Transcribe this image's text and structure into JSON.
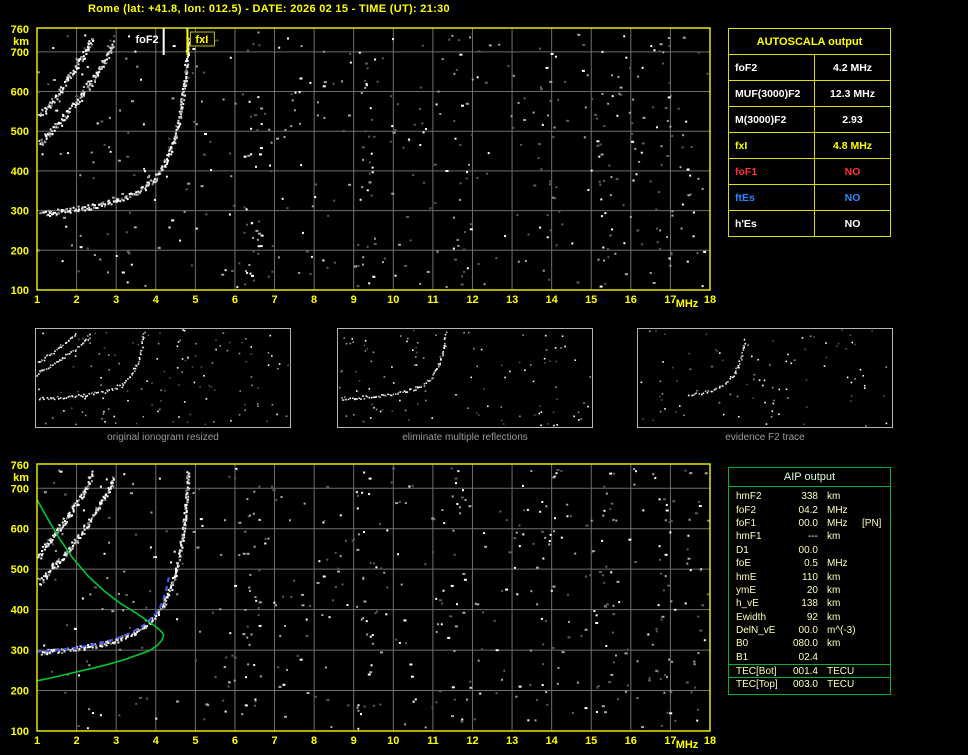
{
  "header": {
    "title": "Rome (lat: +41.8, lon: 012.5) - DATE: 2026 02 15 - TIME (UT): 21:30"
  },
  "autoscala": {
    "title": "AUTOSCALA output",
    "rows": [
      {
        "param": "foF2",
        "value": "4.2 MHz",
        "color": "#ffffff"
      },
      {
        "param": "MUF(3000)F2",
        "value": "12.3 MHz",
        "color": "#ffffff"
      },
      {
        "param": "M(3000)F2",
        "value": "2.93",
        "color": "#ffffff"
      },
      {
        "param": "fxI",
        "value": "4.8 MHz",
        "color": "#ffff00"
      },
      {
        "param": "foF1",
        "value": "NO",
        "color": "#ff3232"
      },
      {
        "param": "ftEs",
        "value": "NO",
        "color": "#2e86ff"
      },
      {
        "param": "h'Es",
        "value": "NO",
        "color": "#ffffff"
      }
    ]
  },
  "aip": {
    "title": "AIP output",
    "rows": [
      {
        "param": "hmF2",
        "value": "338",
        "unit": "km",
        "note": "",
        "sep": false
      },
      {
        "param": "foF2",
        "value": "04.2",
        "unit": "MHz",
        "note": "",
        "sep": false
      },
      {
        "param": "foF1",
        "value": "00.0",
        "unit": "MHz",
        "note": "[PN]",
        "sep": false
      },
      {
        "param": "hmF1",
        "value": "---",
        "unit": "km",
        "note": "",
        "sep": false
      },
      {
        "param": "D1",
        "value": "00.0",
        "unit": "",
        "note": "",
        "sep": false
      },
      {
        "param": "foE",
        "value": "0.5",
        "unit": "MHz",
        "note": "",
        "sep": false
      },
      {
        "param": "hmE",
        "value": "110",
        "unit": "km",
        "note": "",
        "sep": false
      },
      {
        "param": "ymE",
        "value": "20",
        "unit": "km",
        "note": "",
        "sep": false
      },
      {
        "param": "h_vE",
        "value": "138",
        "unit": "km",
        "note": "",
        "sep": false
      },
      {
        "param": "Ewidth",
        "value": "92",
        "unit": "km",
        "note": "",
        "sep": false
      },
      {
        "param": "DelN_vE",
        "value": "00.0",
        "unit": "m^(-3)",
        "note": "",
        "sep": false
      },
      {
        "param": "B0",
        "value": "080.0",
        "unit": "km",
        "note": "",
        "sep": false
      },
      {
        "param": "B1",
        "value": "02.4",
        "unit": "",
        "note": "",
        "sep": false
      },
      {
        "param": "TEC[Bot]",
        "value": "001.4",
        "unit": "TECU",
        "note": "",
        "sep": true
      },
      {
        "param": "TEC[Top]",
        "value": "003.0",
        "unit": "TECU",
        "note": "",
        "sep": true
      }
    ]
  },
  "thumbnails": [
    {
      "caption": "original ionogram resized",
      "trace_names": [
        "F-trace",
        "second-hop-a",
        "second-hop-b"
      ],
      "noise": 130,
      "seed": 41
    },
    {
      "caption": "eliminate multiple reflections",
      "trace_names": [
        "F-trace"
      ],
      "noise": 110,
      "seed": 53
    },
    {
      "caption": "evidence F2 trace",
      "trace_points": [
        [
          2.8,
          320
        ],
        [
          3.2,
          333
        ],
        [
          3.6,
          352
        ],
        [
          3.9,
          375
        ],
        [
          4.1,
          400
        ],
        [
          4.28,
          434
        ],
        [
          4.42,
          470
        ],
        [
          4.53,
          510
        ],
        [
          4.62,
          555
        ],
        [
          4.69,
          602
        ],
        [
          4.74,
          650
        ],
        [
          4.78,
          700
        ]
      ],
      "noise": 90,
      "seed": 67
    }
  ],
  "chart_data": [
    {
      "name": "main-ionogram",
      "type": "scatter",
      "xlabel": "MHz",
      "ylabel": "km",
      "xlim": [
        1,
        18
      ],
      "ylim": [
        100,
        760
      ],
      "xticks": [
        1,
        2,
        3,
        4,
        5,
        6,
        7,
        8,
        9,
        10,
        11,
        12,
        13,
        14,
        15,
        16,
        17,
        18
      ],
      "yticks": [
        100,
        200,
        300,
        400,
        500,
        600,
        700,
        760
      ],
      "grid": true,
      "markers": [
        {
          "label": "foF2",
          "x": 4.2,
          "color": "#ffffff",
          "boxed": false
        },
        {
          "label": "fxI",
          "x": 4.8,
          "color": "#ffff00",
          "boxed": true
        }
      ],
      "noise": {
        "count": 520,
        "seed": 11,
        "band_freqs": [
          6.4,
          9.3,
          11.7,
          13.9,
          15.3,
          16.8
        ],
        "band_fraction": 0.25
      },
      "traces": [
        {
          "name": "F-trace",
          "spread": 5,
          "density": 2,
          "points": [
            [
              1.1,
              296
            ],
            [
              1.6,
              300
            ],
            [
              2.1,
              307
            ],
            [
              2.6,
              316
            ],
            [
              3.0,
              327
            ],
            [
              3.4,
              342
            ],
            [
              3.7,
              360
            ],
            [
              3.95,
              381
            ],
            [
              4.12,
              404
            ],
            [
              4.28,
              434
            ],
            [
              4.42,
              470
            ],
            [
              4.53,
              510
            ],
            [
              4.62,
              555
            ],
            [
              4.69,
              602
            ],
            [
              4.74,
              650
            ],
            [
              4.78,
              700
            ],
            [
              4.81,
              745
            ]
          ]
        },
        {
          "name": "second-hop-a",
          "spread": 8,
          "density": 2,
          "points": [
            [
              1.05,
              468
            ],
            [
              1.35,
              500
            ],
            [
              1.7,
              540
            ],
            [
              2.05,
              585
            ],
            [
              2.4,
              632
            ],
            [
              2.7,
              682
            ],
            [
              2.95,
              728
            ]
          ]
        },
        {
          "name": "second-hop-b",
          "spread": 7,
          "density": 2,
          "points": [
            [
              1.05,
              540
            ],
            [
              1.35,
              575
            ],
            [
              1.65,
              615
            ],
            [
              1.95,
              658
            ],
            [
              2.2,
              700
            ],
            [
              2.4,
              740
            ]
          ]
        }
      ]
    },
    {
      "name": "profile-ionogram",
      "type": "scatter",
      "xlabel": "MHz",
      "ylabel": "km",
      "xlim": [
        1,
        18
      ],
      "ylim": [
        100,
        760
      ],
      "xticks": [
        1,
        2,
        3,
        4,
        5,
        6,
        7,
        8,
        9,
        10,
        11,
        12,
        13,
        14,
        15,
        16,
        17,
        18
      ],
      "yticks": [
        100,
        200,
        300,
        400,
        500,
        600,
        700,
        760
      ],
      "grid": true,
      "noise": {
        "count": 520,
        "seed": 29,
        "band_freqs": [
          6.4,
          9.3,
          11.7,
          13.9,
          15.3,
          16.8
        ],
        "band_fraction": 0.25
      },
      "traces": [
        {
          "name": "F-trace",
          "spread": 5,
          "density": 2,
          "points": [
            [
              1.1,
              296
            ],
            [
              1.6,
              300
            ],
            [
              2.1,
              307
            ],
            [
              2.6,
              316
            ],
            [
              3.0,
              327
            ],
            [
              3.4,
              342
            ],
            [
              3.7,
              360
            ],
            [
              3.95,
              381
            ],
            [
              4.12,
              404
            ],
            [
              4.28,
              434
            ],
            [
              4.42,
              470
            ],
            [
              4.53,
              510
            ],
            [
              4.62,
              555
            ],
            [
              4.69,
              602
            ],
            [
              4.74,
              650
            ],
            [
              4.78,
              700
            ],
            [
              4.81,
              745
            ]
          ]
        },
        {
          "name": "second-hop-a",
          "spread": 8,
          "density": 2,
          "points": [
            [
              1.05,
              468
            ],
            [
              1.35,
              500
            ],
            [
              1.7,
              540
            ],
            [
              2.05,
              585
            ],
            [
              2.4,
              632
            ],
            [
              2.7,
              682
            ],
            [
              2.95,
              728
            ]
          ]
        },
        {
          "name": "second-hop-b",
          "spread": 7,
          "density": 2,
          "points": [
            [
              1.05,
              540
            ],
            [
              1.35,
              575
            ],
            [
              1.65,
              615
            ],
            [
              1.95,
              658
            ],
            [
              2.2,
              700
            ],
            [
              2.4,
              740
            ]
          ]
        }
      ],
      "curves": [
        {
          "name": "electron-density-profile",
          "color": "#00c832",
          "style": "solid",
          "points": [
            [
              1.0,
              672
            ],
            [
              1.25,
              628
            ],
            [
              1.55,
              578
            ],
            [
              1.9,
              528
            ],
            [
              2.3,
              482
            ],
            [
              2.7,
              446
            ],
            [
              3.1,
              416
            ],
            [
              3.5,
              392
            ],
            [
              3.8,
              372
            ],
            [
              4.0,
              358
            ],
            [
              4.12,
              348
            ],
            [
              4.2,
              338
            ],
            [
              4.16,
              326
            ],
            [
              4.05,
              312
            ],
            [
              3.85,
              299
            ],
            [
              3.55,
              288
            ],
            [
              3.2,
              276
            ],
            [
              2.8,
              265
            ],
            [
              2.4,
              255
            ],
            [
              2.0,
              246
            ],
            [
              1.6,
              237
            ],
            [
              1.3,
              230
            ],
            [
              1.0,
              224
            ]
          ]
        },
        {
          "name": "restored-trace",
          "color": "#4a5aff",
          "style": "dashed",
          "points": [
            [
              1.0,
              296
            ],
            [
              1.5,
              300
            ],
            [
              2.0,
              306
            ],
            [
              2.5,
              315
            ],
            [
              3.0,
              328
            ],
            [
              3.4,
              344
            ],
            [
              3.7,
              362
            ],
            [
              3.95,
              384
            ],
            [
              4.1,
              404
            ],
            [
              4.2,
              428
            ],
            [
              4.28,
              455
            ],
            [
              4.33,
              480
            ]
          ]
        }
      ]
    }
  ]
}
